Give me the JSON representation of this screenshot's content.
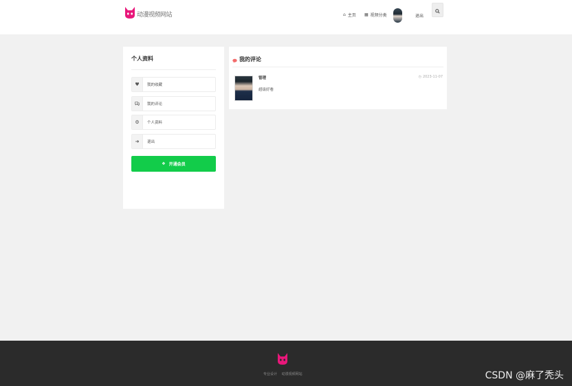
{
  "header": {
    "site_name": "动漫视频网站",
    "nav": {
      "home": "主页",
      "categories": "视频分类"
    },
    "logout": "退出"
  },
  "sidebar": {
    "title": "个人资料",
    "items": [
      {
        "label": "我的收藏",
        "icon": "heart-icon"
      },
      {
        "label": "我的评论",
        "icon": "comments-icon"
      },
      {
        "label": "个人资料",
        "icon": "gears-icon"
      },
      {
        "label": "退出",
        "icon": "sign-out-icon"
      }
    ],
    "vip_button": "开通会员"
  },
  "main": {
    "title": "我的评论",
    "comments": [
      {
        "user": "管理",
        "text": "超级好看",
        "time": "2023-11-07"
      }
    ]
  },
  "footer": {
    "links": [
      "专业设计",
      "动漫视频网站"
    ]
  },
  "watermark": "CSDN @麻了秃头",
  "colors": {
    "brand": "#e8177a",
    "vip": "#12cc4a",
    "footer_bg": "#2b2b2b",
    "accent_icon": "#f36b6b"
  }
}
